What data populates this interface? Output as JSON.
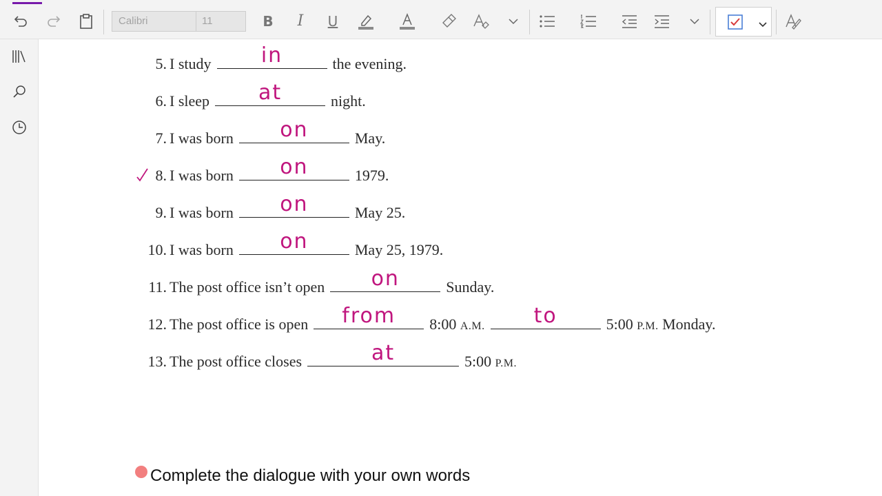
{
  "toolbar": {
    "font_name": "Calibri",
    "font_size": "11",
    "accent_color": "#7719aa",
    "icons": [
      "undo-icon",
      "redo-icon",
      "clipboard-icon",
      "bold-icon",
      "italic-icon",
      "underline-icon",
      "highlight-icon",
      "font-color-icon",
      "format-painter-icon",
      "clear-format-icon",
      "chevron-down-icon",
      "bullets-icon",
      "numbering-icon",
      "outdent-icon",
      "indent-icon",
      "chevron-down-icon",
      "todo-tag-icon",
      "chevron-down-icon",
      "draw-icon"
    ],
    "labels": {
      "bold": "B",
      "italic": "I",
      "underline": "U"
    }
  },
  "rail": {
    "icons": [
      "notebooks-icon",
      "search-icon",
      "recent-icon"
    ]
  },
  "exercise": {
    "ink_color": "#c0167e",
    "items": [
      {
        "num": "5.",
        "before": "I study",
        "answer": "in",
        "after": "the evening."
      },
      {
        "num": "6.",
        "before": "I sleep",
        "answer": "at",
        "after": "night."
      },
      {
        "num": "7.",
        "before": "I was born",
        "answer": "on",
        "after": "May."
      },
      {
        "num": "8.",
        "before": "I was born",
        "answer": "on",
        "after": "1979."
      },
      {
        "num": "9.",
        "before": "I was born",
        "answer": "on",
        "after": "May 25."
      },
      {
        "num": "10.",
        "before": "I was born",
        "answer": "on",
        "after": "May 25, 1979."
      },
      {
        "num": "11.",
        "before": "The post office isn’t open",
        "answer": "on",
        "after": "Sunday."
      },
      {
        "num": "12.",
        "before": "The post office is open",
        "answer": "from",
        "mid": "8:00",
        "mid_sc": "A.M.",
        "answer2": "to",
        "after": "5:00",
        "after_sc": "P.M.",
        "after2": "Monday."
      },
      {
        "num": "13.",
        "before": "The post office closes",
        "answer": "at",
        "after": "5:00",
        "after_sc": "P.M."
      }
    ]
  },
  "prompt": {
    "text": "Complete the dialogue with your own words",
    "dot_color": "#f27f7f"
  }
}
